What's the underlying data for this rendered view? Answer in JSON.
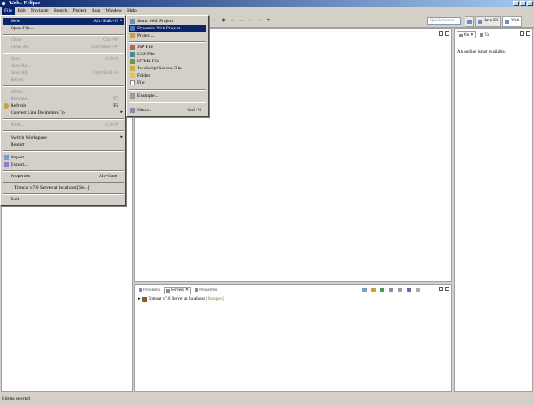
{
  "window": {
    "title": "Web - Eclipse"
  },
  "menubar": [
    "File",
    "Edit",
    "Navigate",
    "Search",
    "Project",
    "Run",
    "Window",
    "Help"
  ],
  "quick_access": {
    "placeholder": "Quick Access"
  },
  "perspectives": [
    {
      "label": "Java EE"
    },
    {
      "label": "Web"
    }
  ],
  "file_menu": {
    "items": [
      {
        "label": "New",
        "accel": "Alt+Shift+N",
        "submenu": true,
        "state": "highlighted"
      },
      {
        "label": "Open File...",
        "accel": "",
        "state": "enabled"
      },
      {
        "label": "Close",
        "accel": "Ctrl+W",
        "state": "disabled"
      },
      {
        "label": "Close All",
        "accel": "Ctrl+Shift+W",
        "state": "disabled"
      },
      {
        "label": "Save",
        "accel": "Ctrl+S",
        "state": "disabled"
      },
      {
        "label": "Save As...",
        "accel": "",
        "state": "disabled"
      },
      {
        "label": "Save All",
        "accel": "Ctrl+Shift+S",
        "state": "disabled"
      },
      {
        "label": "Revert",
        "accel": "",
        "state": "disabled"
      },
      {
        "label": "Move...",
        "accel": "",
        "state": "disabled"
      },
      {
        "label": "Rename...",
        "accel": "F2",
        "state": "disabled"
      },
      {
        "label": "Refresh",
        "accel": "F5",
        "state": "enabled",
        "icon": "refresh-icon"
      },
      {
        "label": "Convert Line Delimiters To",
        "accel": "",
        "submenu": true,
        "state": "enabled"
      },
      {
        "label": "Print...",
        "accel": "Ctrl+P",
        "state": "disabled"
      },
      {
        "label": "Switch Workspace",
        "accel": "",
        "submenu": true,
        "state": "enabled"
      },
      {
        "label": "Restart",
        "accel": "",
        "state": "enabled"
      },
      {
        "label": "Import...",
        "accel": "",
        "state": "enabled",
        "icon": "import-icon"
      },
      {
        "label": "Export...",
        "accel": "",
        "state": "enabled",
        "icon": "export-icon"
      },
      {
        "label": "Properties",
        "accel": "Alt+Enter",
        "state": "enabled"
      },
      {
        "label": "1 Tomcat v7.0 Server at localhost [Se...]",
        "accel": "",
        "state": "enabled"
      },
      {
        "label": "Exit",
        "accel": "",
        "state": "enabled"
      }
    ]
  },
  "new_submenu": {
    "items": [
      {
        "label": "Static Web Project",
        "state": "enabled"
      },
      {
        "label": "Dynamic Web Project",
        "state": "highlighted"
      },
      {
        "label": "Project...",
        "state": "enabled"
      },
      {
        "label": "JSP File",
        "state": "enabled"
      },
      {
        "label": "CSS File",
        "state": "enabled"
      },
      {
        "label": "HTML File",
        "state": "enabled"
      },
      {
        "label": "JavaScript Source File",
        "state": "enabled"
      },
      {
        "label": "Folder",
        "state": "enabled"
      },
      {
        "label": "File",
        "state": "enabled"
      },
      {
        "label": "Example...",
        "state": "enabled"
      },
      {
        "label": "Other...",
        "accel": "Ctrl+N",
        "state": "enabled"
      }
    ]
  },
  "right_panel": {
    "tabs": [
      "Ou",
      "Ta"
    ],
    "message": "An outline is not available."
  },
  "bottom_panel": {
    "tabs": [
      "Problems",
      "Servers",
      "Properties"
    ],
    "servers": [
      {
        "name": "Tomcat v7.0 Server at localhost",
        "status": "[Stopped]"
      }
    ]
  },
  "statusbar": {
    "text": "0 items selected"
  }
}
